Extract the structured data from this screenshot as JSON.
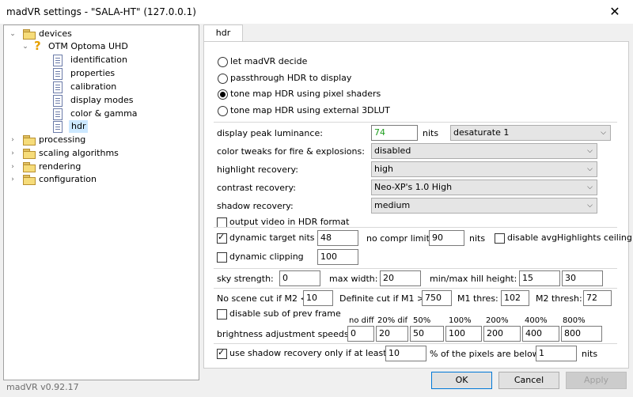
{
  "window": {
    "title": "madVR settings - \"SALA-HT\" (127.0.0.1)",
    "close": "✕"
  },
  "tree": {
    "devices": "devices",
    "device": "OTM Optoma UHD",
    "children": [
      "identification",
      "properties",
      "calibration",
      "display modes",
      "color & gamma",
      "hdr"
    ],
    "processing": "processing",
    "scaling": "scaling algorithms",
    "rendering": "rendering",
    "configuration": "configuration"
  },
  "tab": {
    "label": "hdr"
  },
  "modes": [
    {
      "label": "let madVR decide",
      "checked": false
    },
    {
      "label": "passthrough HDR to display",
      "checked": false
    },
    {
      "label": "tone map HDR using pixel shaders",
      "checked": true
    },
    {
      "label": "tone map HDR using external 3DLUT",
      "checked": false
    }
  ],
  "peak": {
    "label": "display peak luminance:",
    "value": "74",
    "unit": "nits",
    "mode": "desaturate 1",
    "value_color": "#1e9e1e"
  },
  "fire": {
    "label": "color tweaks for fire & explosions:",
    "value": "disabled"
  },
  "highlight": {
    "label": "highlight recovery:",
    "value": "high"
  },
  "contrast": {
    "label": "contrast recovery:",
    "value": "Neo-XP's 1.0 High"
  },
  "shadow": {
    "label": "shadow recovery:",
    "value": "medium"
  },
  "output_hdr": {
    "label": "output video in HDR format",
    "checked": false
  },
  "dyn_target": {
    "label": "dynamic target nits",
    "checked": true,
    "value": "48",
    "no_compr_label": "no compr limit:",
    "no_compr_value": "90",
    "nits": "nits"
  },
  "disable_avg": {
    "label": "disable avgHighlights ceiling",
    "checked": false
  },
  "dyn_clip": {
    "label": "dynamic clipping",
    "checked": false,
    "value": "100"
  },
  "sky": {
    "label": "sky strength:",
    "value": "0",
    "max_width_label": "max width:",
    "max_width": "20",
    "hill_label": "min/max hill height:",
    "hill_min": "15",
    "hill_max": "30"
  },
  "scene": {
    "no_cut_label": "No scene cut if M2 <",
    "no_cut": "10",
    "def_cut_label": "Definite cut if M1 >",
    "def_cut": "750",
    "m1_label": "M1 thres:",
    "m1": "102",
    "m2_label": "M2 thresh:",
    "m2": "72"
  },
  "disable_sub": {
    "label": "disable sub of prev frame",
    "checked": false
  },
  "brightness": {
    "label": "brightness adjustment speeds:",
    "headers": [
      "no diff",
      "20% dif",
      "50%",
      "100%",
      "200%",
      "400%",
      "800%"
    ],
    "values": [
      "0",
      "20",
      "50",
      "100",
      "200",
      "400",
      "800"
    ]
  },
  "shadow_only": {
    "label": "use shadow recovery only if at least:",
    "checked": true,
    "value": "10",
    "mid": "% of the pixels are below",
    "value2": "1",
    "unit": "nits"
  },
  "buttons": {
    "ok": "OK",
    "cancel": "Cancel",
    "apply": "Apply"
  },
  "version": "madVR v0.92.17"
}
